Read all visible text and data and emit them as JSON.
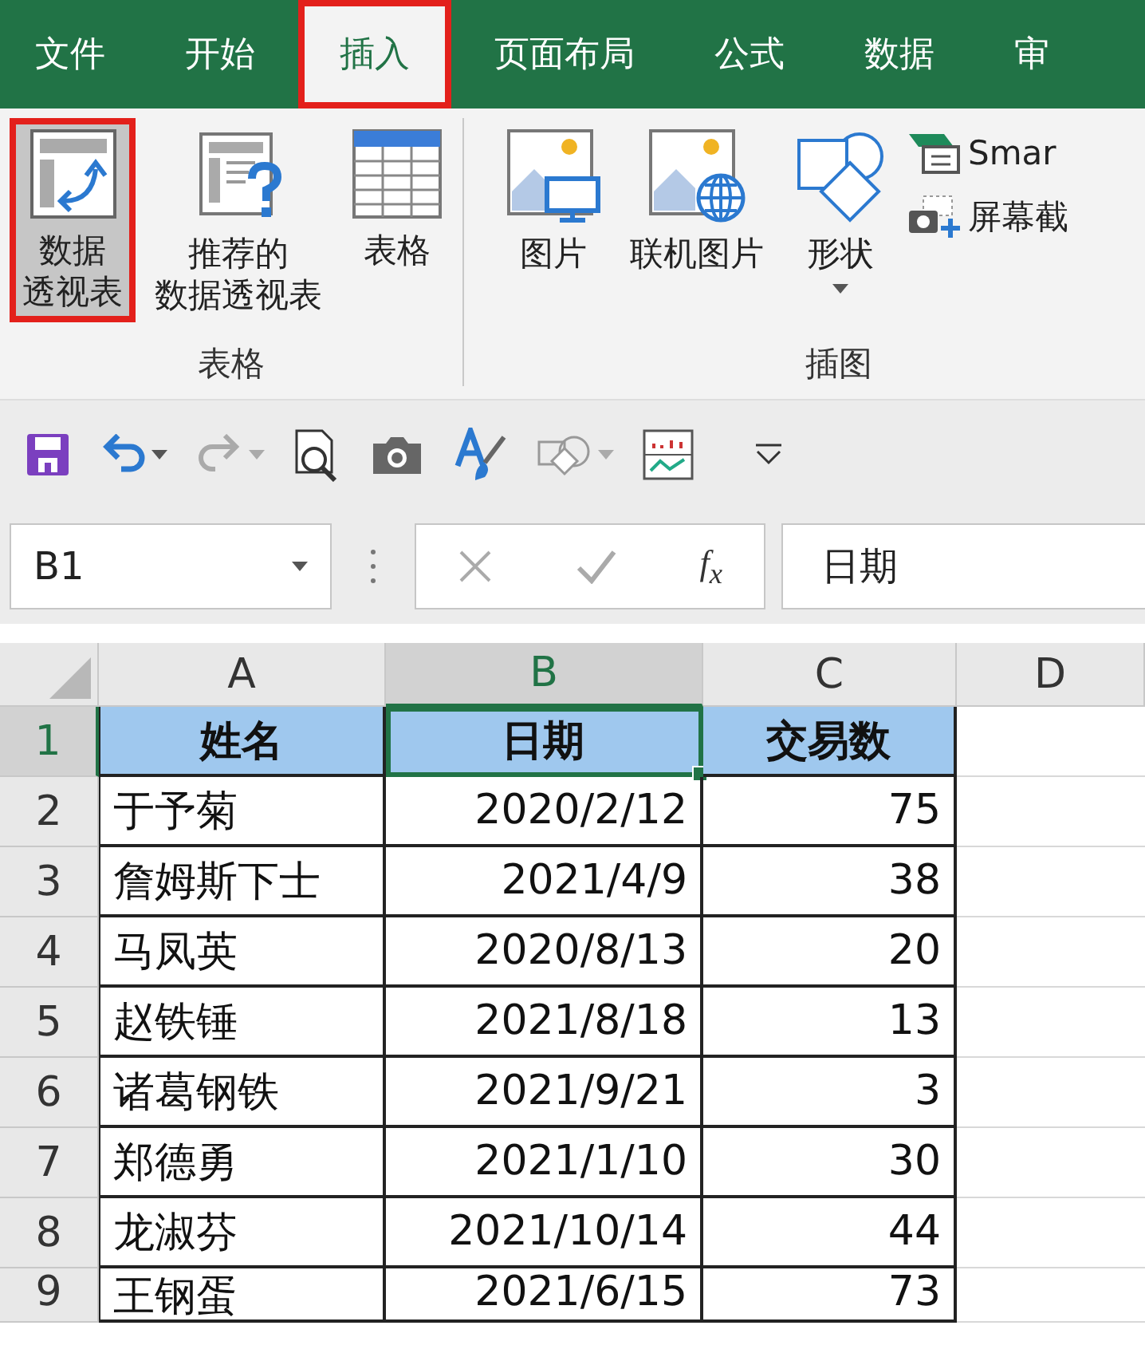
{
  "tabs": [
    {
      "label": "文件",
      "selected": false
    },
    {
      "label": "开始",
      "selected": false
    },
    {
      "label": "插入",
      "selected": true
    },
    {
      "label": "页面布局",
      "selected": false
    },
    {
      "label": "公式",
      "selected": false
    },
    {
      "label": "数据",
      "selected": false
    },
    {
      "label": "审",
      "selected": false
    }
  ],
  "ribbon": {
    "groups": [
      {
        "label": "表格",
        "buttons": [
          {
            "kind": "pivot",
            "label_lines": [
              "数据",
              "透视表"
            ],
            "selected": true,
            "dropdown": false
          },
          {
            "kind": "recommended",
            "label_lines": [
              "推荐的",
              "数据透视表"
            ],
            "selected": false,
            "dropdown": false
          },
          {
            "kind": "table",
            "label_lines": [
              "表格"
            ],
            "selected": false,
            "dropdown": false
          }
        ]
      },
      {
        "label": "插图",
        "buttons": [
          {
            "kind": "picture",
            "label_lines": [
              "图片"
            ],
            "selected": false,
            "dropdown": false
          },
          {
            "kind": "online-picture",
            "label_lines": [
              "联机图片"
            ],
            "selected": false,
            "dropdown": false
          },
          {
            "kind": "shapes",
            "label_lines": [
              "形状"
            ],
            "selected": false,
            "dropdown": true
          }
        ],
        "small_buttons": [
          {
            "kind": "smartart",
            "label": "Smar"
          },
          {
            "kind": "screenshot",
            "label": "屏幕截"
          }
        ]
      }
    ]
  },
  "formula_bar": {
    "name_box": "B1",
    "function_label": "f$_{x}$",
    "value": "日期"
  },
  "sheet": {
    "columns": [
      {
        "label": "A",
        "selected": false
      },
      {
        "label": "B",
        "selected": true
      },
      {
        "label": "C",
        "selected": false
      },
      {
        "label": "D",
        "selected": false
      }
    ],
    "rows": [
      {
        "number": "1",
        "kind": "header",
        "selected": true,
        "cells": [
          {
            "text": "姓名",
            "active": false
          },
          {
            "text": "日期",
            "active": true
          },
          {
            "text": "交易数",
            "active": false
          }
        ]
      },
      {
        "number": "2",
        "kind": "data",
        "selected": false,
        "cells": [
          {
            "text": "于予菊",
            "active": false
          },
          {
            "text": "2020/2/12",
            "active": false
          },
          {
            "text": "75",
            "active": false
          }
        ]
      },
      {
        "number": "3",
        "kind": "data",
        "selected": false,
        "cells": [
          {
            "text": "詹姆斯下士",
            "active": false
          },
          {
            "text": "2021/4/9",
            "active": false
          },
          {
            "text": "38",
            "active": false
          }
        ]
      },
      {
        "number": "4",
        "kind": "data",
        "selected": false,
        "cells": [
          {
            "text": "马凤英",
            "active": false
          },
          {
            "text": "2020/8/13",
            "active": false
          },
          {
            "text": "20",
            "active": false
          }
        ]
      },
      {
        "number": "5",
        "kind": "data",
        "selected": false,
        "cells": [
          {
            "text": "赵铁锤",
            "active": false
          },
          {
            "text": "2021/8/18",
            "active": false
          },
          {
            "text": "13",
            "active": false
          }
        ]
      },
      {
        "number": "6",
        "kind": "data",
        "selected": false,
        "cells": [
          {
            "text": "诸葛钢铁",
            "active": false
          },
          {
            "text": "2021/9/21",
            "active": false
          },
          {
            "text": "3",
            "active": false
          }
        ]
      },
      {
        "number": "7",
        "kind": "data",
        "selected": false,
        "cells": [
          {
            "text": "郑德勇",
            "active": false
          },
          {
            "text": "2021/1/10",
            "active": false
          },
          {
            "text": "30",
            "active": false
          }
        ]
      },
      {
        "number": "8",
        "kind": "data",
        "selected": false,
        "cells": [
          {
            "text": "龙淑芬",
            "active": false
          },
          {
            "text": "2021/10/14",
            "active": false
          },
          {
            "text": "44",
            "active": false
          }
        ]
      },
      {
        "number": "9",
        "kind": "data",
        "selected": false,
        "cells": [
          {
            "text": "王钢蛋",
            "active": false
          },
          {
            "text": "2021/6/15",
            "active": false
          },
          {
            "text": "73",
            "active": false
          }
        ]
      }
    ]
  }
}
